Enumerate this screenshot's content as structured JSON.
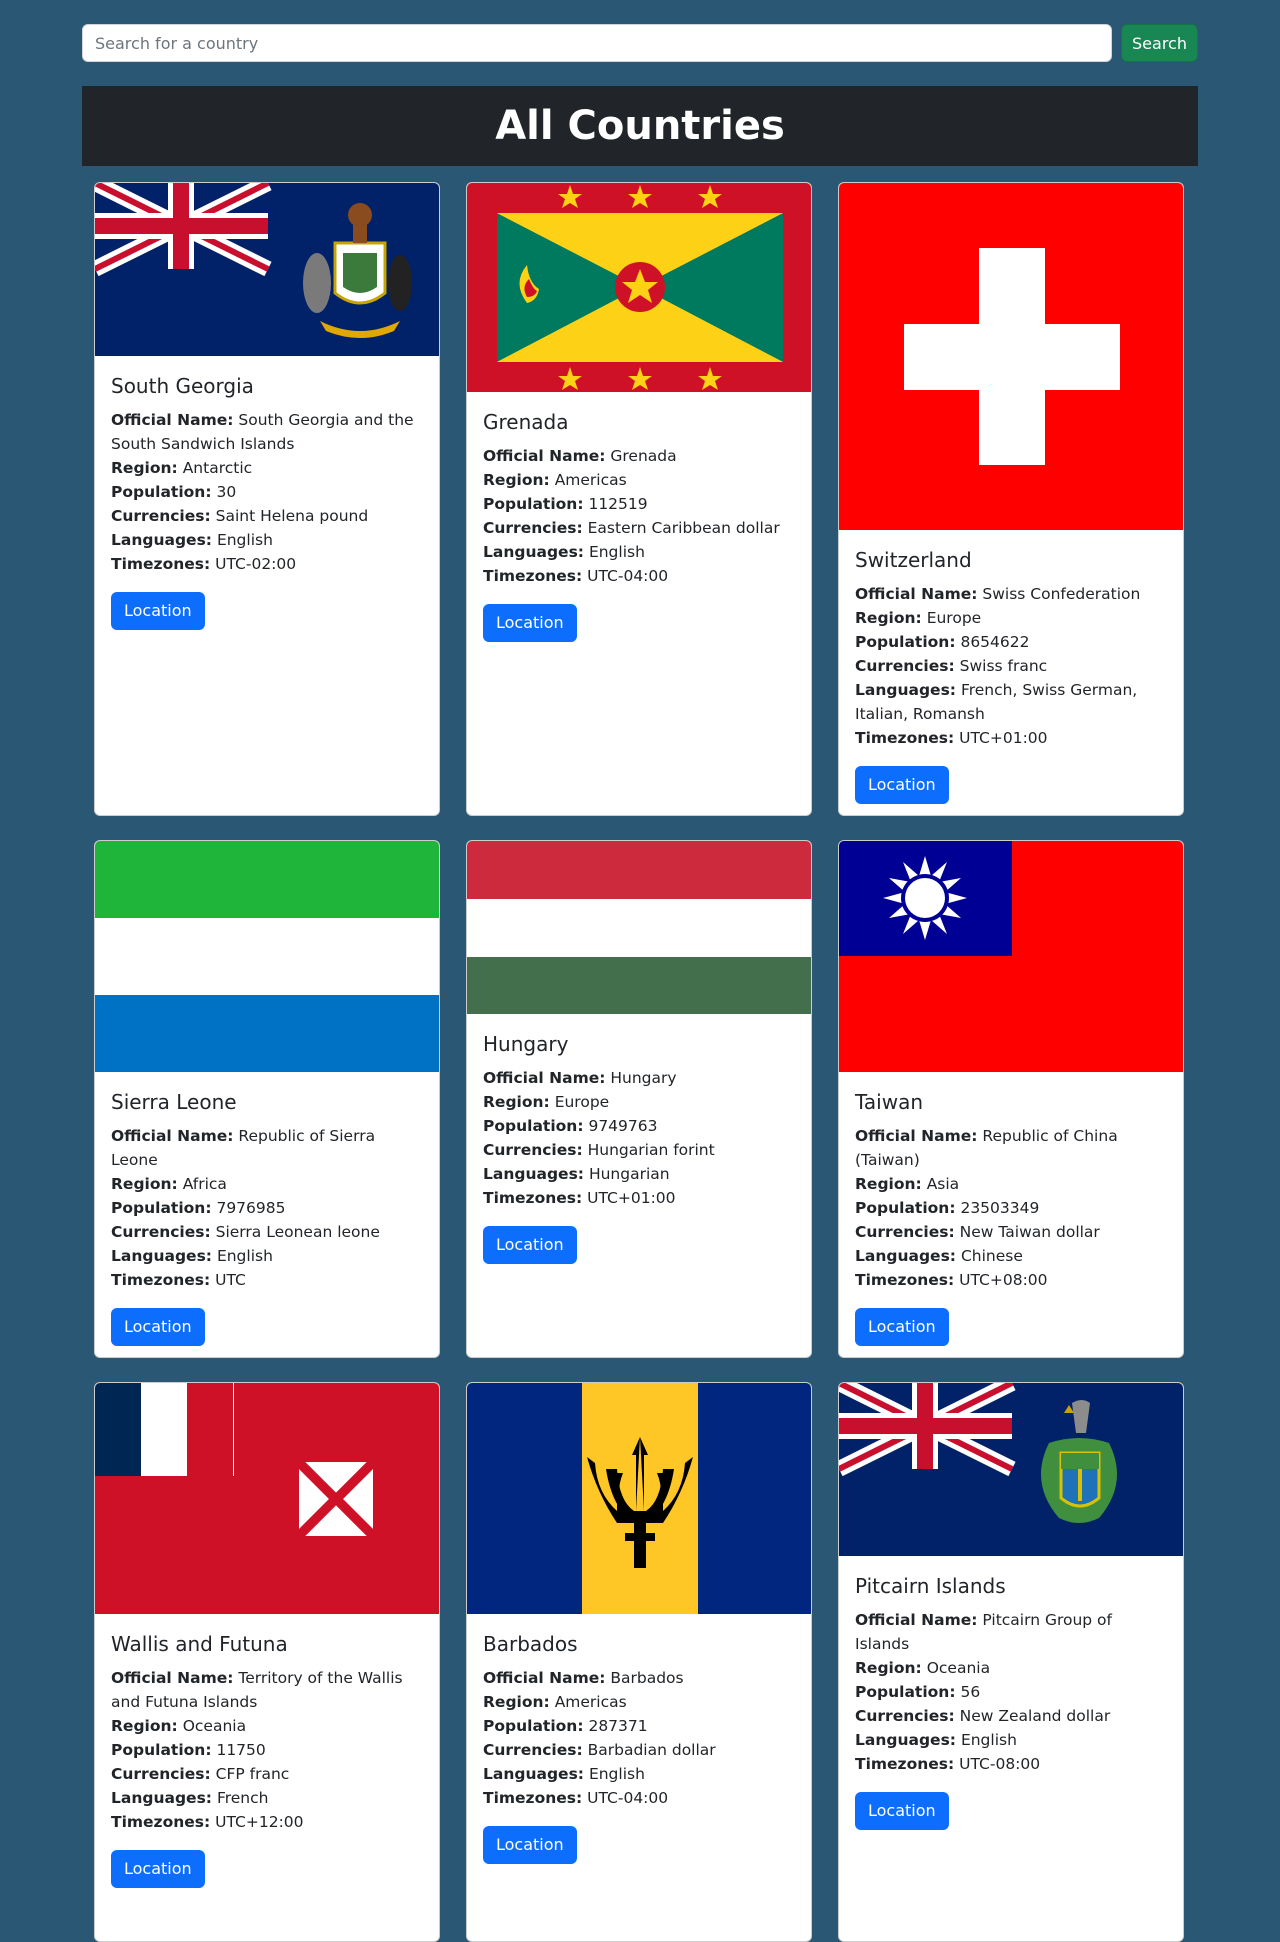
{
  "search": {
    "placeholder": "Search for a country",
    "button_label": "Search"
  },
  "header": {
    "title": "All Countries"
  },
  "labels": {
    "official_name": "Official Name:",
    "region": "Region:",
    "population": "Population:",
    "currencies": "Currencies:",
    "languages": "Languages:",
    "timezones": "Timezones:",
    "location_button": "Location"
  },
  "countries": [
    {
      "name": "South Georgia",
      "official_name": "South Georgia and the South Sandwich Islands",
      "region": "Antarctic",
      "population": "30",
      "currencies": "Saint Helena pound",
      "languages": "English",
      "timezones": "UTC-02:00"
    },
    {
      "name": "Grenada",
      "official_name": "Grenada",
      "region": "Americas",
      "population": "112519",
      "currencies": "Eastern Caribbean dollar",
      "languages": "English",
      "timezones": "UTC-04:00"
    },
    {
      "name": "Switzerland",
      "official_name": "Swiss Confederation",
      "region": "Europe",
      "population": "8654622",
      "currencies": "Swiss franc",
      "languages": "French, Swiss German, Italian, Romansh",
      "timezones": "UTC+01:00"
    },
    {
      "name": "Sierra Leone",
      "official_name": "Republic of Sierra Leone",
      "region": "Africa",
      "population": "7976985",
      "currencies": "Sierra Leonean leone",
      "languages": "English",
      "timezones": "UTC"
    },
    {
      "name": "Hungary",
      "official_name": "Hungary",
      "region": "Europe",
      "population": "9749763",
      "currencies": "Hungarian forint",
      "languages": "Hungarian",
      "timezones": "UTC+01:00"
    },
    {
      "name": "Taiwan",
      "official_name": "Republic of China (Taiwan)",
      "region": "Asia",
      "population": "23503349",
      "currencies": "New Taiwan dollar",
      "languages": "Chinese",
      "timezones": "UTC+08:00"
    },
    {
      "name": "Wallis and Futuna",
      "official_name": "Territory of the Wallis and Futuna Islands",
      "region": "Oceania",
      "population": "11750",
      "currencies": "CFP franc",
      "languages": "French",
      "timezones": "UTC+12:00"
    },
    {
      "name": "Barbados",
      "official_name": "Barbados",
      "region": "Americas",
      "population": "287371",
      "currencies": "Barbadian dollar",
      "languages": "English",
      "timezones": "UTC-04:00"
    },
    {
      "name": "Pitcairn Islands",
      "official_name": "Pitcairn Group of Islands",
      "region": "Oceania",
      "population": "56",
      "currencies": "New Zealand dollar",
      "languages": "English",
      "timezones": "UTC-08:00"
    }
  ]
}
